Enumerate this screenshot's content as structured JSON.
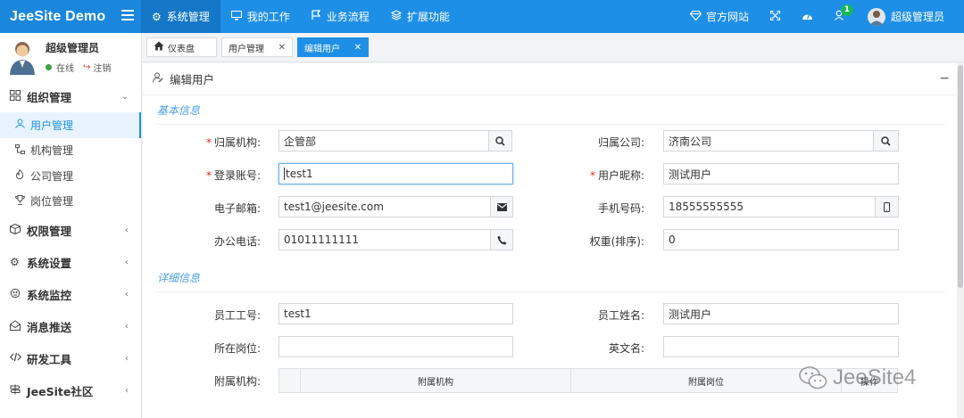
{
  "app": {
    "brand": "JeeSite Demo"
  },
  "topnav": [
    {
      "icon": "gear-icon",
      "label": "系统管理"
    },
    {
      "icon": "monitor-icon",
      "label": "我的工作"
    },
    {
      "icon": "flow-icon",
      "label": "业务流程"
    },
    {
      "icon": "layers-icon",
      "label": "扩展功能"
    }
  ],
  "topright": {
    "website": "官方网站",
    "notify_badge": "1",
    "user": "超级管理员"
  },
  "user_panel": {
    "name": "超级管理员",
    "online": "在线",
    "logout": "注销"
  },
  "sidebar": {
    "group_org": "组织管理",
    "org_items": [
      "用户管理",
      "机构管理",
      "公司管理",
      "岗位管理"
    ],
    "groups": [
      "权限管理",
      "系统设置",
      "系统监控",
      "消息推送",
      "研发工具",
      "JeeSite社区"
    ]
  },
  "tabs": {
    "home": "仪表盘",
    "user": "用户管理",
    "edit": "编辑用户"
  },
  "box": {
    "title": "编辑用户"
  },
  "section_basic": "基本信息",
  "section_detail": "详细信息",
  "form": {
    "office_label": "归属机构:",
    "office_value": "企管部",
    "company_label": "归属公司:",
    "company_value": "济南公司",
    "login_label": "登录账号:",
    "login_value": "test1",
    "nick_label": "用户昵称:",
    "nick_value": "测试用户",
    "email_label": "电子邮箱:",
    "email_value": "test1@jeesite.com",
    "mobile_label": "手机号码:",
    "mobile_value": "18555555555",
    "phone_label": "办公电话:",
    "phone_value": "01011111111",
    "weight_label": "权重(排序):",
    "weight_value": "0",
    "empno_label": "员工工号:",
    "empno_value": "test1",
    "empname_label": "员工姓名:",
    "empname_value": "测试用户",
    "post_label": "所在岗位:",
    "post_value": "",
    "ename_label": "英文名:",
    "ename_value": "",
    "suboffice_label": "附属机构:"
  },
  "sub_table": {
    "col1": "附属机构",
    "col2": "附属岗位",
    "col3": "操作"
  },
  "watermark": "JeeSite4"
}
